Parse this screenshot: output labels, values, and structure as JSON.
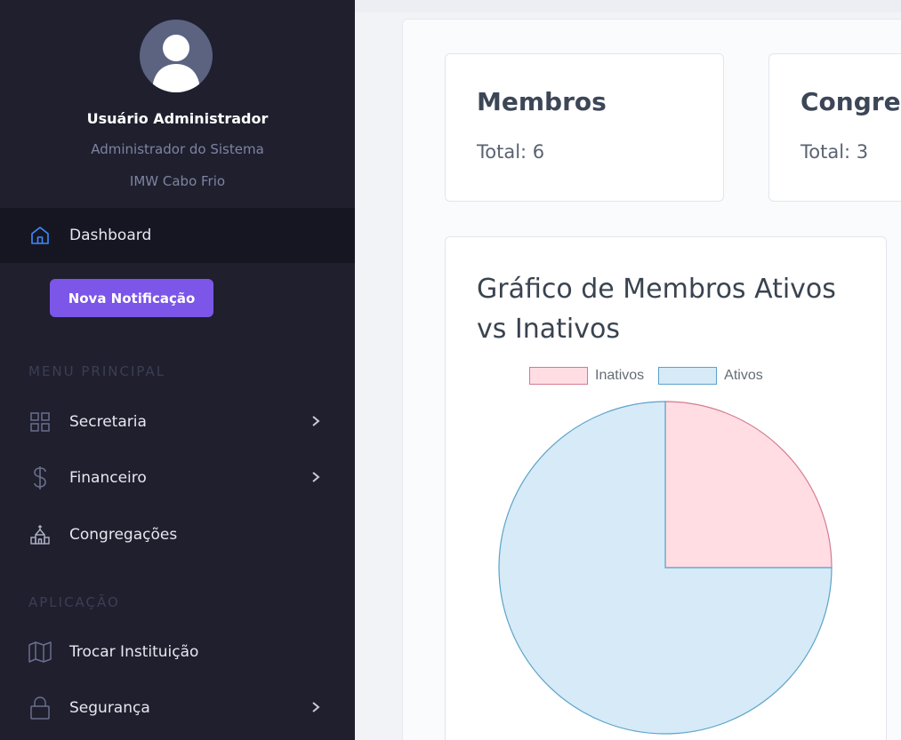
{
  "user": {
    "name": "Usuário Administrador",
    "role": "Administrador do Sistema",
    "institution": "IMW Cabo Frio"
  },
  "nav": {
    "dashboard": "Dashboard",
    "notification_button": "Nova Notificação",
    "section_main": "MENU PRINCIPAL",
    "secretaria": "Secretaria",
    "financeiro": "Financeiro",
    "congregacoes": "Congregações",
    "section_app": "APLICAÇÃO",
    "trocar": "Trocar Instituição",
    "seguranca": "Segurança"
  },
  "cards": {
    "membros": {
      "title": "Membros",
      "total": "Total: 6"
    },
    "congregacoes": {
      "title": "Congre",
      "total": "Total: 3"
    }
  },
  "chart": {
    "title": "Gráfico de Membros Ativos vs Inativos"
  },
  "chart_data": {
    "type": "pie",
    "title": "Gráfico de Membros Ativos vs Inativos",
    "legend_position": "top",
    "series": [
      {
        "name": "Inativos",
        "value": 1,
        "color": "#ffdde3",
        "border": "#d47a8f"
      },
      {
        "name": "Ativos",
        "value": 3,
        "color": "#d6eaf8",
        "border": "#5aa3c9"
      }
    ]
  },
  "colors": {
    "sidebar_bg": "#1f1f2e",
    "accent_purple": "#7c56e8",
    "active_icon": "#3d8bfd"
  }
}
